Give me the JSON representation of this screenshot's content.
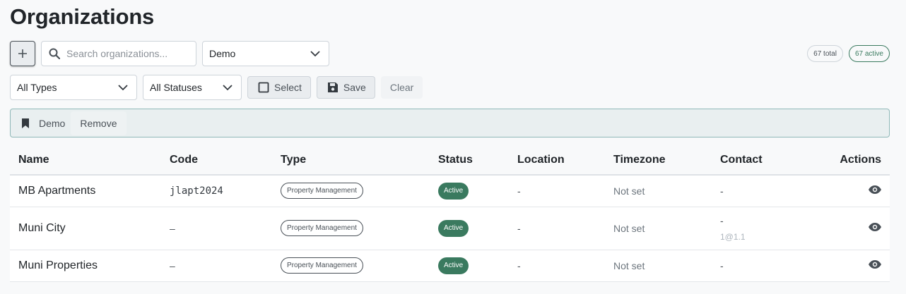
{
  "page": {
    "title": "Organizations"
  },
  "toolbar": {
    "add_icon": "plus-icon",
    "search_placeholder": "Search organizations...",
    "preset_value": "Demo",
    "type_filter": "All Types",
    "status_filter": "All Statuses",
    "select_label": "Select",
    "save_label": "Save",
    "clear_label": "Clear"
  },
  "counts": {
    "total": "67 total",
    "active": "67 active"
  },
  "saved_filter": {
    "name": "Demo",
    "remove_label": "Remove"
  },
  "table": {
    "headers": {
      "name": "Name",
      "code": "Code",
      "type": "Type",
      "status": "Status",
      "location": "Location",
      "timezone": "Timezone",
      "contact": "Contact",
      "actions": "Actions"
    },
    "rows": [
      {
        "name": "MB Apartments",
        "code": "jlapt2024",
        "type": "Property Management",
        "status": "Active",
        "location": "-",
        "timezone": "Not set",
        "contact": "-",
        "contact_sub": ""
      },
      {
        "name": "Muni City",
        "code": "–",
        "type": "Property Management",
        "status": "Active",
        "location": "-",
        "timezone": "Not set",
        "contact": "-",
        "contact_sub": "1@1.1"
      },
      {
        "name": "Muni Properties",
        "code": "–",
        "type": "Property Management",
        "status": "Active",
        "location": "-",
        "timezone": "Not set",
        "contact": "-",
        "contact_sub": ""
      }
    ]
  },
  "colors": {
    "accent_green": "#3a7a5f",
    "filter_border": "#8fb8b8"
  }
}
